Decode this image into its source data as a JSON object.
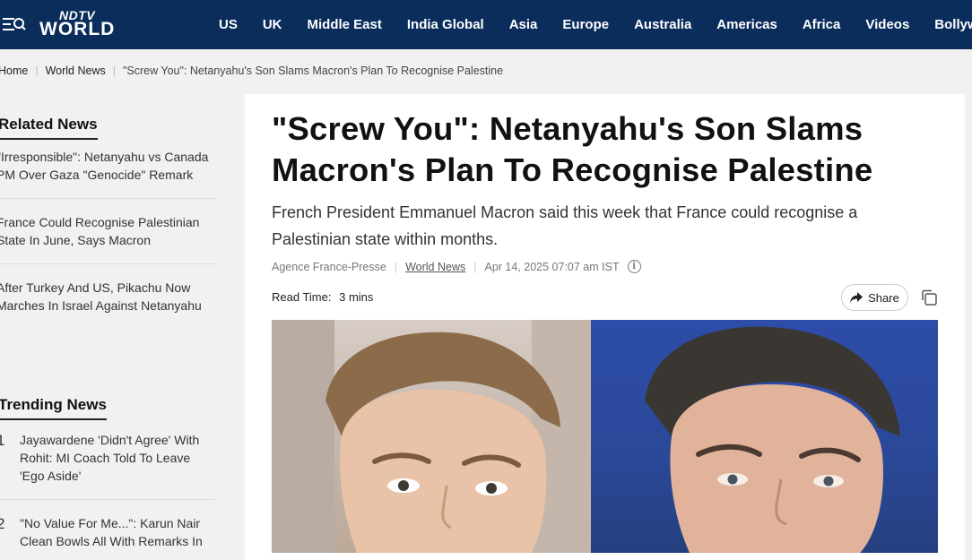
{
  "brand": {
    "top": "NDTV",
    "bottom": "WORLD"
  },
  "nav": [
    "US",
    "UK",
    "Middle East",
    "India Global",
    "Asia",
    "Europe",
    "Australia",
    "Americas",
    "Africa",
    "Videos",
    "Bollywood"
  ],
  "breadcrumb": {
    "home": "Home",
    "section": "World News",
    "current": "\"Screw You\": Netanyahu's Son Slams Macron's Plan To Recognise Palestine"
  },
  "related": {
    "heading": "Related News",
    "items": [
      "\"Irresponsible\": Netanyahu vs Canada PM Over Gaza \"Genocide\" Remark",
      "France Could Recognise Palestinian State In June, Says Macron",
      "After Turkey And US, Pikachu Now Marches In Israel Against Netanyahu"
    ]
  },
  "trending": {
    "heading": "Trending News",
    "items": [
      {
        "num": "1",
        "text": "Jayawardene 'Didn't Agree' With Rohit: MI Coach Told To Leave 'Ego Aside'"
      },
      {
        "num": "2",
        "text": "\"No Value For Me...\": Karun Nair Clean Bowls All With Remarks In"
      }
    ]
  },
  "article": {
    "headline": "\"Screw You\": Netanyahu's Son Slams Macron's Plan To Recognise Palestine",
    "summary": "French President Emmanuel Macron said this week that France could recognise a Palestinian state within months.",
    "source": "Agence France-Presse",
    "category": "World News",
    "timestamp": "Apr 14, 2025 07:07 am IST",
    "read_time_label": "Read Time:",
    "read_time_value": "3 mins",
    "share_label": "Share"
  },
  "icons": {
    "menu": "menu-search-icon",
    "info": "info-icon",
    "share": "share-arrow-icon",
    "copy": "copy-icon"
  },
  "colors": {
    "nav_bg": "#0a2d5c",
    "page_bg": "#f1f1f1",
    "card_bg": "#ffffff"
  }
}
